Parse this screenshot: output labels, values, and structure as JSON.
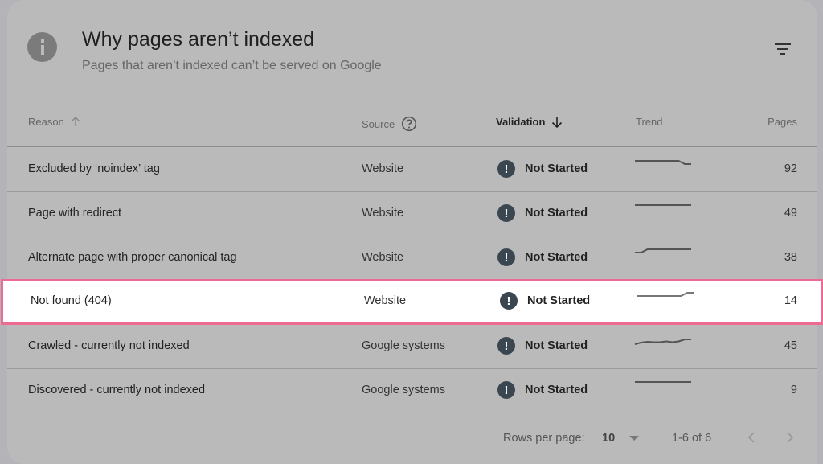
{
  "header": {
    "title": "Why pages aren’t indexed",
    "subtitle": "Pages that aren’t indexed can’t be served on Google",
    "info_icon": "info-icon",
    "filter_icon": "filter-icon"
  },
  "columns": {
    "reason": "Reason",
    "source": "Source",
    "validation": "Validation",
    "trend": "Trend",
    "pages": "Pages"
  },
  "sort": {
    "reason": "ascending-inactive",
    "validation": "descending-active"
  },
  "rows": [
    {
      "reason": "Excluded by ‘noindex’ tag",
      "source": "Website",
      "validation": "Not Started",
      "pages": "92",
      "trend": [
        1,
        1,
        1,
        1,
        1,
        1,
        1,
        1,
        0.6,
        0.6
      ],
      "highlighted": false
    },
    {
      "reason": "Page with redirect",
      "source": "Website",
      "validation": "Not Started",
      "pages": "49",
      "trend": [
        1,
        1,
        1,
        1,
        1,
        1,
        1,
        1,
        1,
        1
      ],
      "highlighted": false
    },
    {
      "reason": "Alternate page with proper canonical tag",
      "source": "Website",
      "validation": "Not Started",
      "pages": "38",
      "trend": [
        0.6,
        0.6,
        1,
        1,
        1,
        1,
        1,
        1,
        1,
        1
      ],
      "highlighted": false
    },
    {
      "reason": "Not found (404)",
      "source": "Website",
      "validation": "Not Started",
      "pages": "14",
      "trend": [
        0.6,
        0.6,
        0.6,
        0.6,
        0.6,
        0.6,
        0.6,
        0.6,
        1,
        1
      ],
      "highlighted": true
    },
    {
      "reason": "Crawled - currently not indexed",
      "source": "Google systems",
      "validation": "Not Started",
      "pages": "45",
      "trend": [
        0.2,
        0.4,
        0.5,
        0.45,
        0.45,
        0.55,
        0.45,
        0.55,
        0.8,
        0.8
      ],
      "highlighted": false
    },
    {
      "reason": "Discovered - currently not indexed",
      "source": "Google systems",
      "validation": "Not Started",
      "pages": "9",
      "trend": [
        1,
        1,
        1,
        1,
        1,
        1,
        1,
        1,
        1,
        1
      ],
      "highlighted": false
    }
  ],
  "footer": {
    "rows_per_page_label": "Rows per page:",
    "rows_per_page_value": "10",
    "range": "1-6 of 6"
  },
  "colors": {
    "highlight_border": "#ef6a93",
    "status_icon": "#3a4650"
  }
}
